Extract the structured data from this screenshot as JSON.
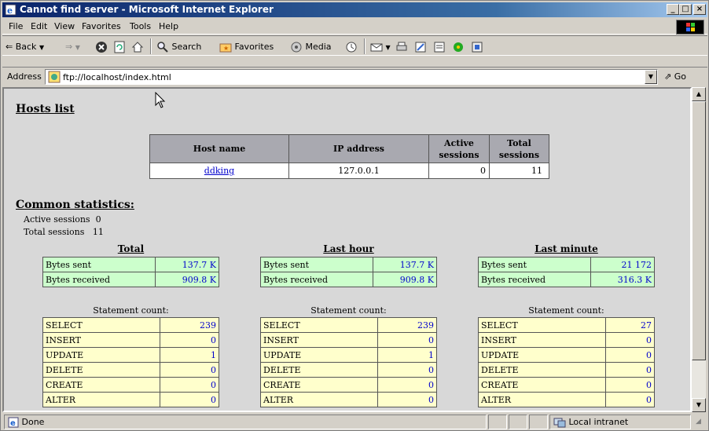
{
  "window": {
    "title": "Cannot find server - Microsoft Internet Explorer"
  },
  "menu": [
    "File",
    "Edit",
    "View",
    "Favorites",
    "Tools",
    "Help"
  ],
  "toolbar": {
    "back": "Back",
    "search": "Search",
    "favorites": "Favorites",
    "media": "Media"
  },
  "address": {
    "label": "Address",
    "url": "ftp://localhost/index.html",
    "go": "Go"
  },
  "page": {
    "hosts_title": "Hosts list",
    "hosts_headers": [
      "Host name",
      "IP address",
      "Active sessions",
      "Total sessions"
    ],
    "hosts_rows": [
      {
        "host": "ddking",
        "ip": "127.0.0.1",
        "active": "0",
        "total": "11"
      }
    ],
    "common_title": "Common statistics:",
    "active_label": "Active sessions",
    "active_value": "0",
    "total_label": "Total sessions",
    "total_value": "11",
    "groups": [
      {
        "title": "Total",
        "bytes_sent": "137.7 K",
        "bytes_received": "909.8 K",
        "statements": [
          "239",
          "0",
          "1",
          "0",
          "0",
          "0"
        ]
      },
      {
        "title": "Last hour",
        "bytes_sent": "137.7 K",
        "bytes_received": "909.8 K",
        "statements": [
          "239",
          "0",
          "1",
          "0",
          "0",
          "0"
        ]
      },
      {
        "title": "Last minute",
        "bytes_sent": "21 172",
        "bytes_received": "316.3 K",
        "statements": [
          "27",
          "0",
          "0",
          "0",
          "0",
          "0"
        ]
      }
    ],
    "bytes_sent_label": "Bytes sent",
    "bytes_received_label": "Bytes received",
    "statement_count_label": "Statement count:",
    "statement_labels": [
      "SELECT",
      "INSERT",
      "UPDATE",
      "DELETE",
      "CREATE",
      "ALTER"
    ]
  },
  "status": {
    "text": "Done",
    "zone": "Local intranet"
  },
  "colors": {
    "titlebar": "#0a246a",
    "bytes_bg": "#ccffcc",
    "stmt_bg": "#ffffcc",
    "header_bg": "#a9a9b0",
    "value": "#0000cc"
  }
}
